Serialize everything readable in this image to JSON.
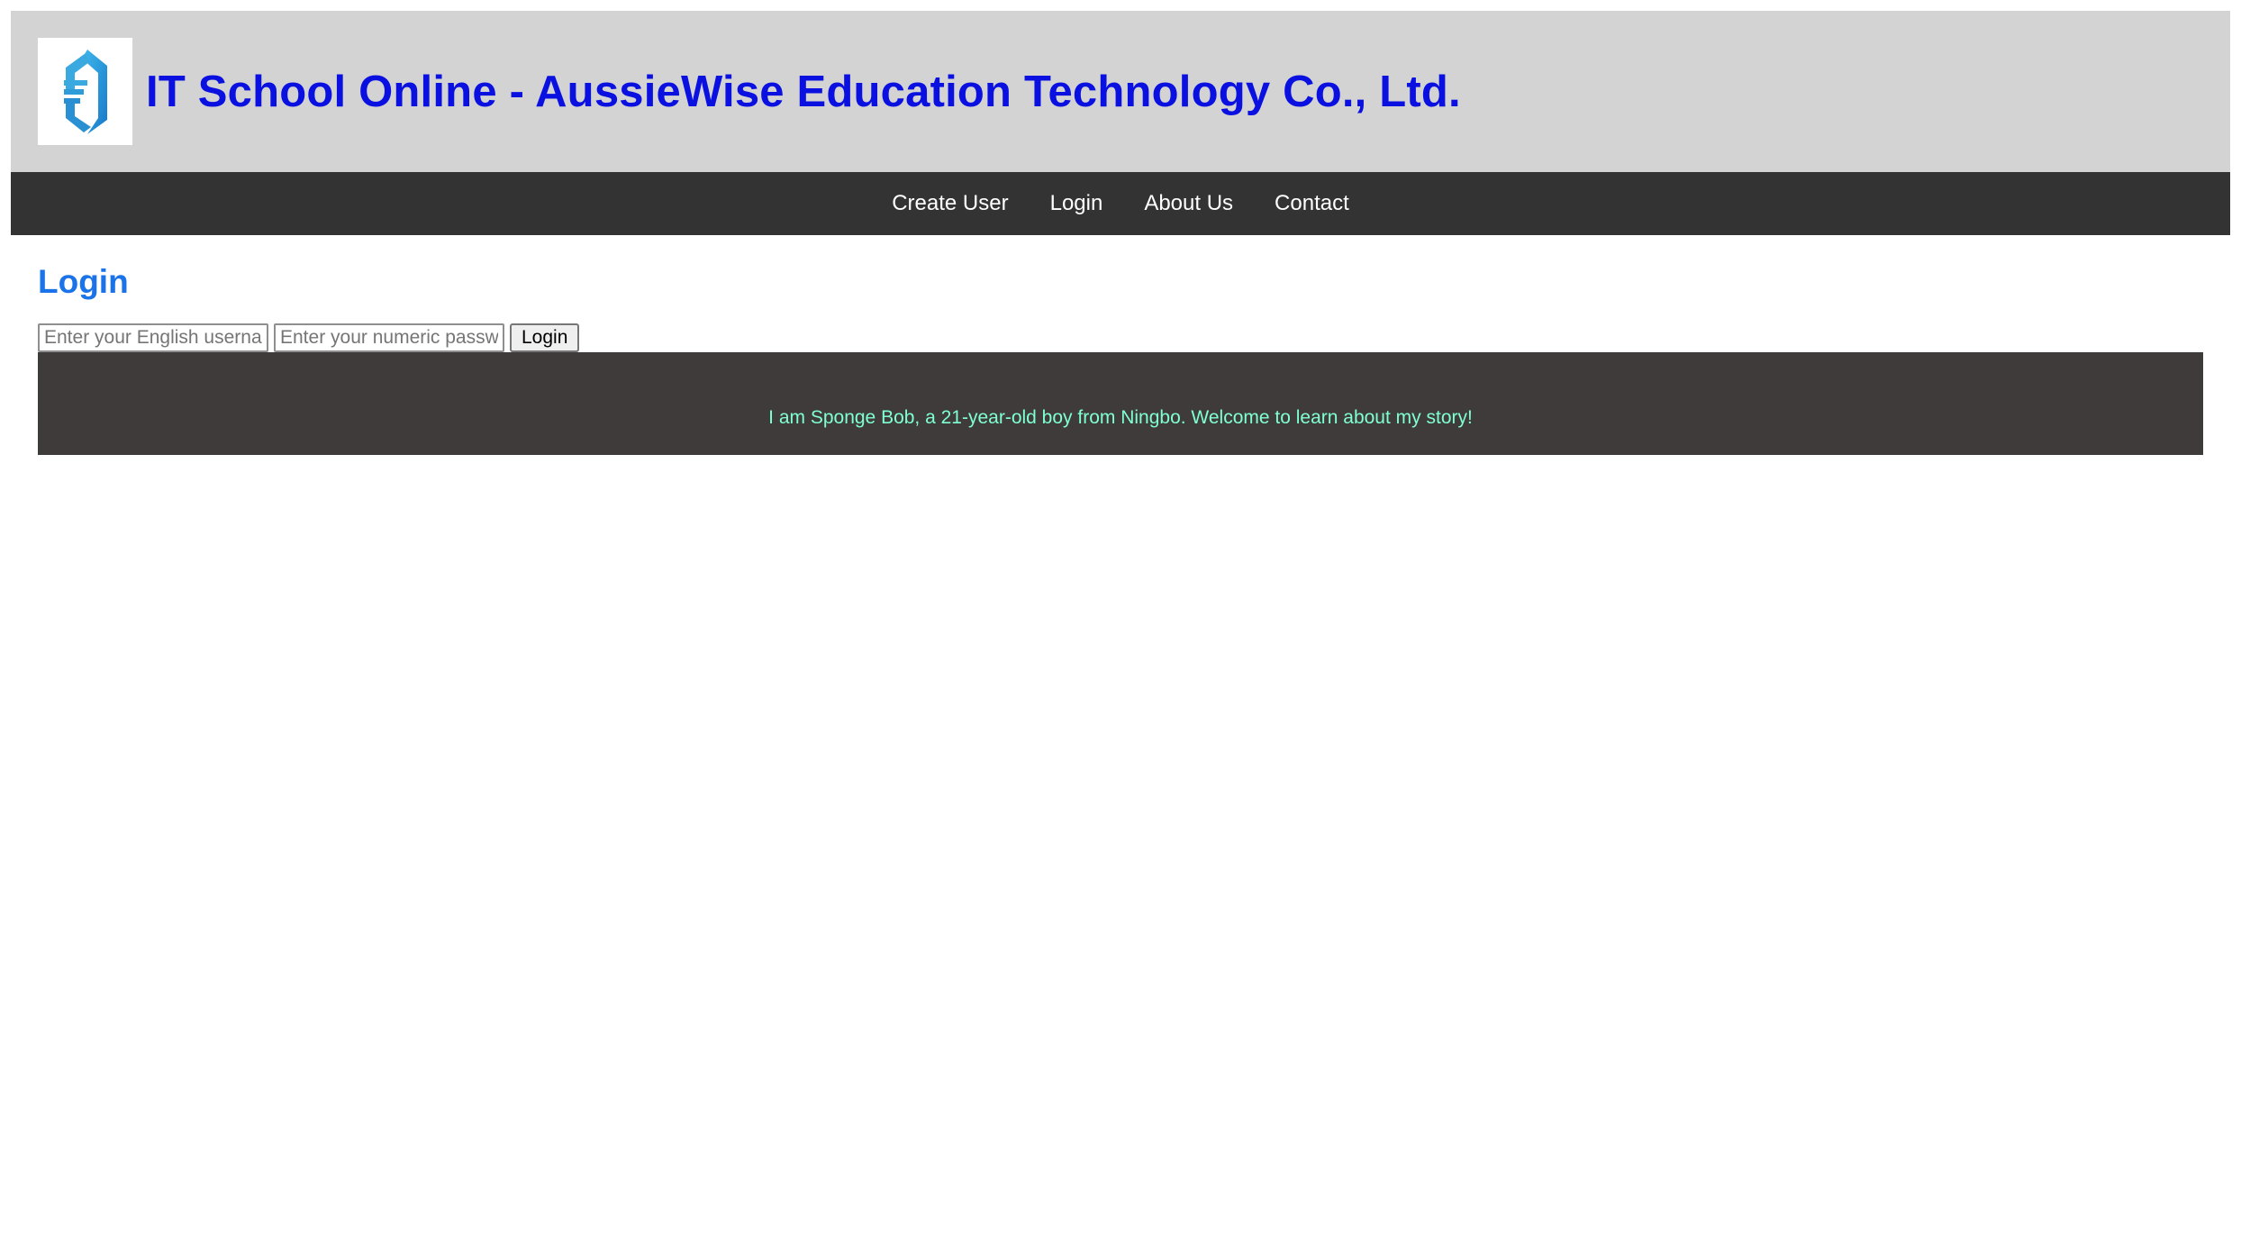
{
  "header": {
    "logo_icon": "aussiewise-logo-icon",
    "title": "IT School Online - AussieWise Education Technology Co., Ltd.",
    "title_color": "#0a10e0",
    "background": "#d3d3d3"
  },
  "nav": {
    "background": "#333333",
    "items": [
      {
        "label": "Create User"
      },
      {
        "label": "Login"
      },
      {
        "label": "About Us"
      },
      {
        "label": "Contact"
      }
    ]
  },
  "main": {
    "heading": "Login",
    "heading_color": "#1a73e8",
    "form": {
      "username_placeholder": "Enter your English username",
      "username_value": "",
      "password_placeholder": "Enter your numeric password",
      "password_value": "",
      "submit_label": "Login"
    },
    "banner": {
      "background": "#3f3b3b",
      "text": "I am Sponge Bob, a 21-year-old boy from Ningbo. Welcome to learn about my story!",
      "text_color": "#7fffd4"
    }
  }
}
